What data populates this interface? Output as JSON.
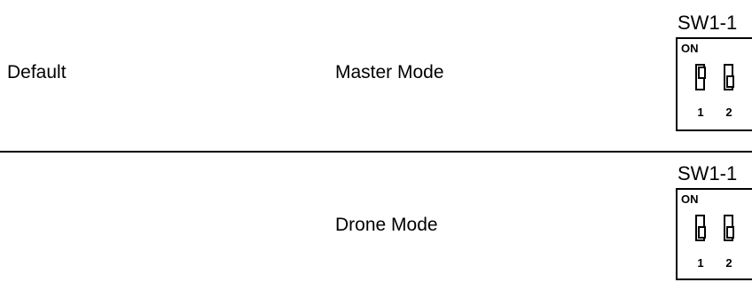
{
  "rows": [
    {
      "setting": "Default",
      "mode": "Master Mode",
      "switch": {
        "title": "SW1-1",
        "on_label": "ON",
        "positions": [
          {
            "number": "1",
            "state": "on"
          },
          {
            "number": "2",
            "state": "off"
          }
        ]
      }
    },
    {
      "setting": "",
      "mode": "Drone Mode",
      "switch": {
        "title": "SW1-1",
        "on_label": "ON",
        "positions": [
          {
            "number": "1",
            "state": "off"
          },
          {
            "number": "2",
            "state": "off"
          }
        ]
      }
    }
  ]
}
